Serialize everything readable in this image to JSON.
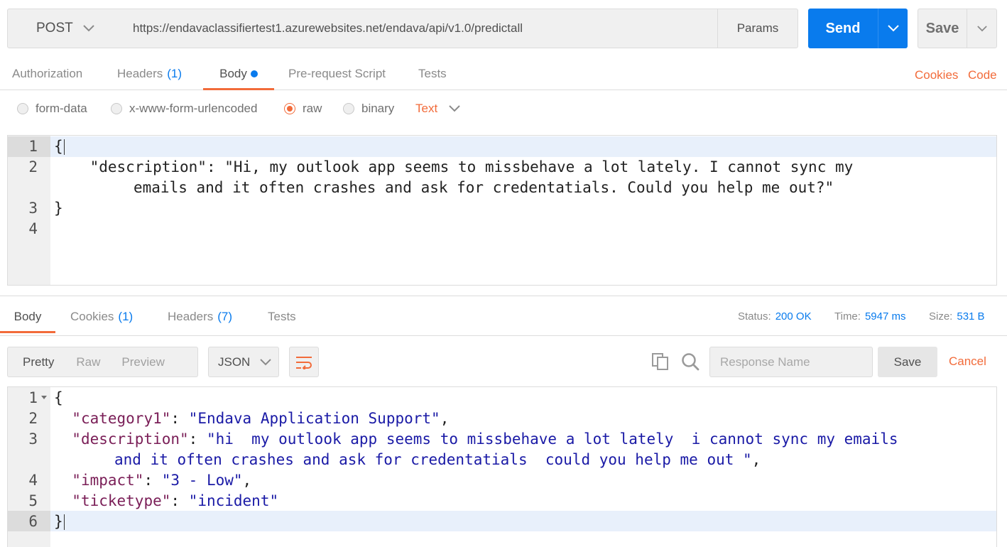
{
  "request": {
    "method": "POST",
    "url": "https://endavaclassifiertest1.azurewebsites.net/endava/api/v1.0/predictall",
    "params_label": "Params",
    "send_label": "Send",
    "save_label": "Save"
  },
  "request_tabs": [
    {
      "label": "Authorization",
      "count": ""
    },
    {
      "label": "Headers",
      "count": "(1)"
    },
    {
      "label": "Body",
      "count": ""
    },
    {
      "label": "Pre-request Script",
      "count": ""
    },
    {
      "label": "Tests",
      "count": ""
    }
  ],
  "links": {
    "cookies": "Cookies",
    "code": "Code"
  },
  "body_types": [
    "form-data",
    "x-www-form-urlencoded",
    "raw",
    "binary"
  ],
  "selected_body_type": "raw",
  "text_type": "Text",
  "request_editor": {
    "line_numbers": [
      "1",
      "2",
      "3",
      "4"
    ],
    "open_brace": "{",
    "key": "\"description\"",
    "colon": ": ",
    "value_line1": "\"Hi, my outlook app seems to missbehave a lot lately. I cannot sync my",
    "value_line2": "emails and it often crashes and ask for credentatials. Could you help me out?\"",
    "close_brace": "}"
  },
  "response_tabs": [
    {
      "label": "Body",
      "count": ""
    },
    {
      "label": "Cookies",
      "count": "(1)"
    },
    {
      "label": "Headers",
      "count": "(7)"
    },
    {
      "label": "Tests",
      "count": ""
    }
  ],
  "status": {
    "status_label": "Status:",
    "status_value": "200 OK",
    "time_label": "Time:",
    "time_value": "5947 ms",
    "size_label": "Size:",
    "size_value": "531 B"
  },
  "response_toolbar": {
    "views": [
      "Pretty",
      "Raw",
      "Preview"
    ],
    "language": "JSON",
    "response_name_placeholder": "Response Name",
    "save_label": "Save",
    "cancel_label": "Cancel"
  },
  "response_editor": {
    "line_numbers": [
      "1",
      "2",
      "3",
      "4",
      "5",
      "6"
    ],
    "open_brace": "{",
    "close_brace": "}",
    "rows": [
      {
        "key": "\"category1\"",
        "value": "\"Endava Application Support\"",
        "trail": ","
      },
      {
        "key": "\"description\"",
        "value": "\"hi  my outlook app seems to missbehave a lot lately  i cannot sync my emails",
        "value2": "and it often crashes and ask for credentatials  could you help me out \"",
        "trail": ","
      },
      {
        "key": "\"impact\"",
        "value": "\"3 - Low\"",
        "trail": ","
      },
      {
        "key": "\"ticketype\"",
        "value": "\"incident\"",
        "trail": ""
      }
    ]
  },
  "colors": {
    "accent_orange": "#f26b3a",
    "accent_blue": "#097bed",
    "json_key": "#7a1e57",
    "json_string": "#1a1aa6"
  }
}
